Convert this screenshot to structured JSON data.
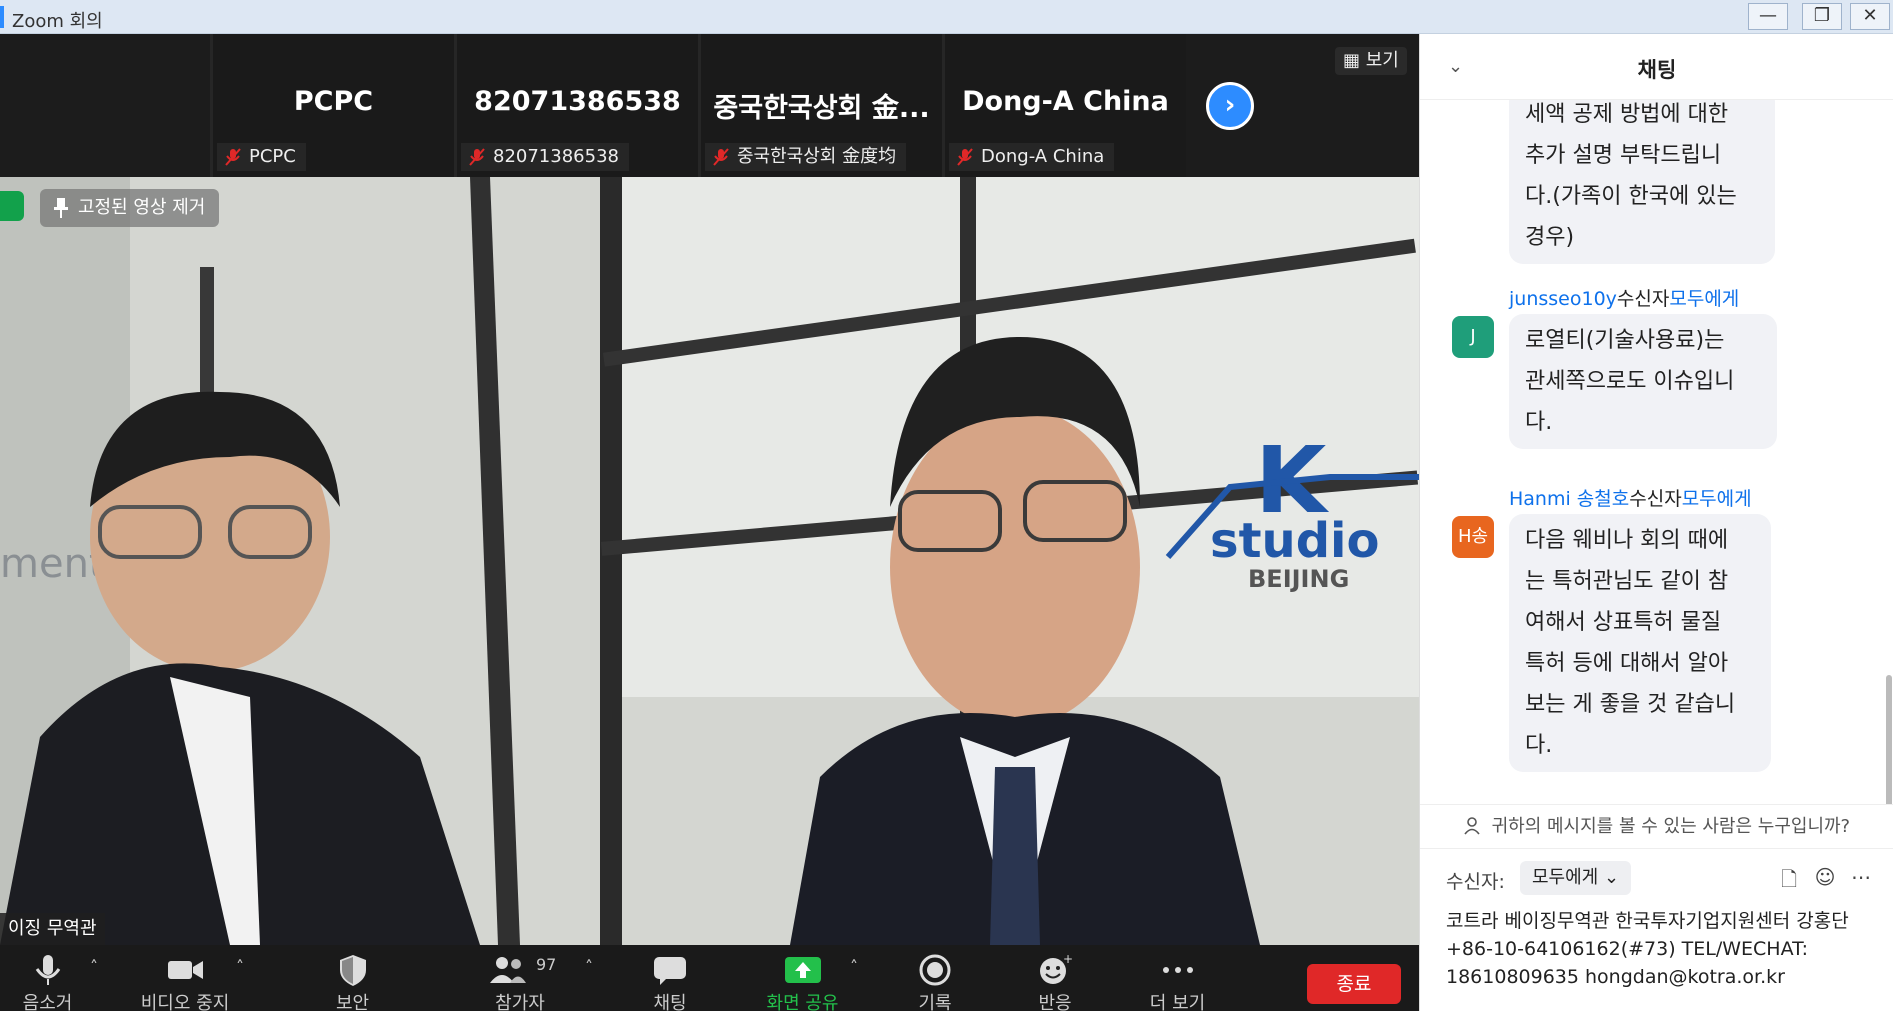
{
  "window": {
    "title": "Zoom 회의",
    "buttons": [
      "—",
      "❐",
      "✕"
    ]
  },
  "thumbnails": [
    {
      "name": "PCPC",
      "label": "PCPC"
    },
    {
      "name": "82071386538",
      "label": "82071386538"
    },
    {
      "name": "중국한국상회 金...",
      "label": "중국한국상회 金度均"
    },
    {
      "name": "Dong-A China",
      "label": "Dong-A China"
    }
  ],
  "view_button": "보기",
  "main_video": {
    "pin_chip": "고정된 영상 제거",
    "speaker_label": "이징 무역관"
  },
  "toolbar": {
    "items": [
      {
        "label": "음소거",
        "icon": "microphone-icon"
      },
      {
        "label": "비디오 중지",
        "icon": "video-camera-icon"
      },
      {
        "label": "보안",
        "icon": "shield-icon"
      },
      {
        "label": "참가자",
        "icon": "participants-icon",
        "count": "97"
      },
      {
        "label": "채팅",
        "icon": "chat-icon"
      },
      {
        "label": "화면 공유",
        "icon": "share-screen-icon"
      },
      {
        "label": "기록",
        "icon": "record-icon"
      },
      {
        "label": "반응",
        "icon": "reaction-icon"
      },
      {
        "label": "더 보기",
        "icon": "more-icon"
      }
    ],
    "end_label": "종료"
  },
  "chat": {
    "title": "채팅",
    "messages": [
      {
        "text": "세액 공제 방법에 대한 추가 설명 부탁드립니다.(가족이 한국에 있는 경우)",
        "lines": [
          "세액 공제 방법에 대한",
          "추가 설명 부탁드립니",
          "다.(가족이 한국에 있는",
          "경우)"
        ]
      },
      {
        "sender": "junsseo10y",
        "to_word": "수신자",
        "to": "모두에게",
        "avatar": "J",
        "avatar_color": "#1f9e7a",
        "lines": [
          "로열티(기술사용료)는",
          "관세쪽으로도 이슈입니",
          "다."
        ]
      },
      {
        "sender": "Hanmi 송철호",
        "to_word": "수신자",
        "to": "모두에게",
        "avatar": "H송",
        "avatar_color": "#e8661f",
        "lines": [
          "다음 웨비나 회의 때에",
          "는 특허관님도 같이 참",
          "여해서 상표특허 물질",
          "특허 등에 대해서 알아",
          "보는 게 좋을 것 같습니",
          "다."
        ]
      }
    ],
    "who_sees": "귀하의 메시지를 볼 수 있는 사람은 누구입니까?",
    "to_label": "수신자:",
    "to_select": "모두에게",
    "draft": "코트라 베이징무역관 한국투자기업지원센터 강홍단 +86-10-64106162(#73) TEL/WECHAT: 18610809635 hongdan@kotra.or.kr"
  }
}
